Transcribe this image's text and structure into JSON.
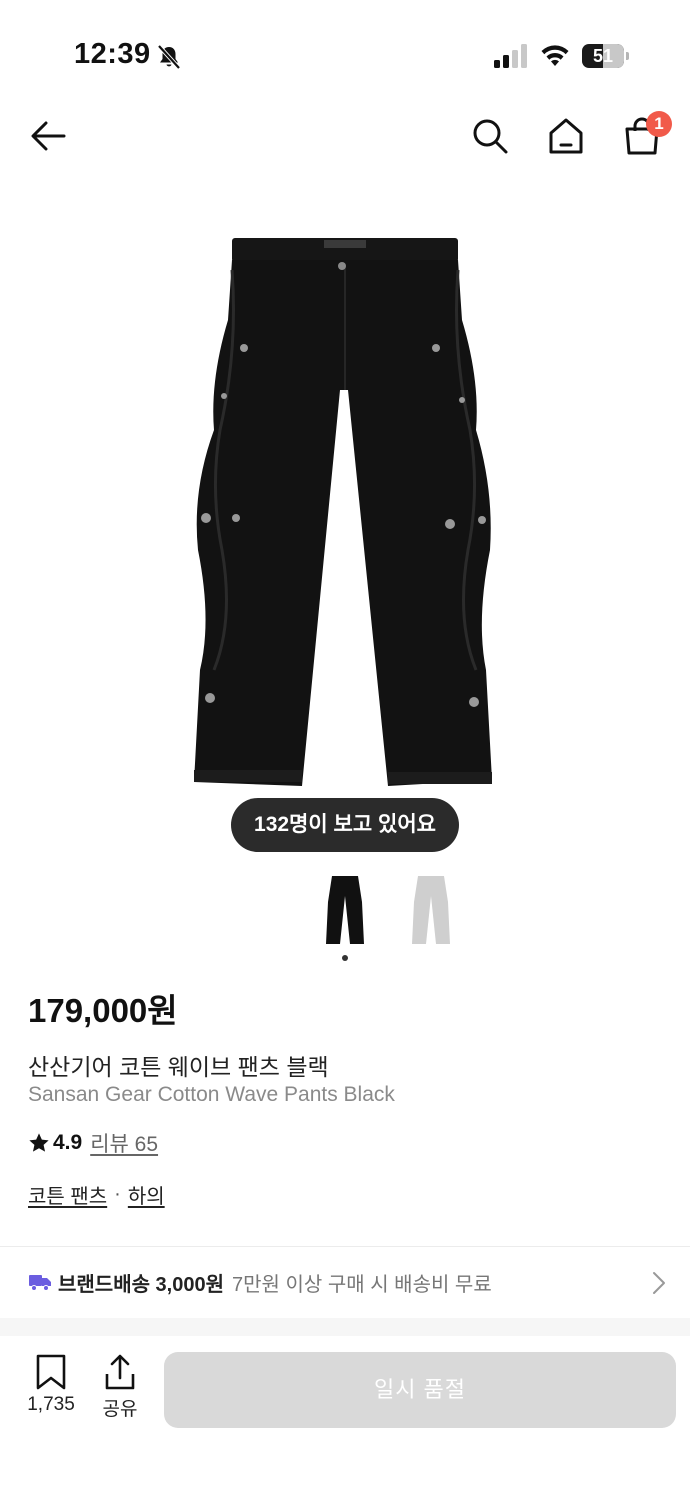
{
  "status_bar": {
    "time": "12:39",
    "battery_level": "51",
    "battery_fraction": 0.51,
    "icons": [
      "bell-slash-icon",
      "cellular-signal-icon",
      "wifi-icon",
      "battery-icon"
    ]
  },
  "nav": {
    "icons": [
      "arrow-left-icon",
      "search-icon",
      "home-icon",
      "shopping-bag-icon"
    ],
    "cart_count": "1",
    "badge_color": "#f15a4a"
  },
  "product": {
    "viewers": "132명이 보고 있어요",
    "thumbnails": [
      "black",
      "gray"
    ],
    "current_image": 1,
    "price": "179,000원",
    "name_ko": "산산기어 코튼 웨이브 팬츠 블랙",
    "name_en": "Sansan Gear Cotton Wave Pants Black",
    "rating": "4.9",
    "review_label": "리뷰 65",
    "categories": [
      "코튼 팬츠",
      "하의"
    ],
    "category_separator": "·"
  },
  "shipping": {
    "label": "브랜드배송 3,000원",
    "note": "7만원 이상 구매 시 배송비 무료",
    "icon_color": "#6b5de0"
  },
  "bottom_bar": {
    "wishlist_count": "1,735",
    "share_label": "공유",
    "soldout_label": "일시 품절"
  }
}
